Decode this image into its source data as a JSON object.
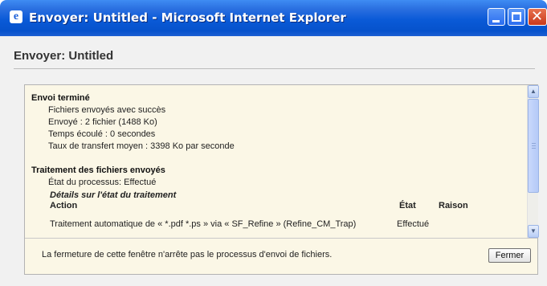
{
  "window": {
    "title": "Envoyer: Untitled - Microsoft Internet Explorer",
    "app_icon": "ie-icon",
    "controls": [
      "minimize-icon",
      "maximize-icon",
      "close-icon"
    ]
  },
  "page": {
    "title": "Envoyer: Untitled"
  },
  "upload": {
    "title": "Envoi terminé",
    "lines": [
      "Fichiers envoyés avec succès",
      "Envoyé : 2 fichier (1488 Ko)",
      "Temps écoulé : 0 secondes",
      "Taux de transfert moyen : 3398 Ko par seconde"
    ]
  },
  "processing": {
    "title": "Traitement des fichiers envoyés",
    "status_line": "État du processus: Effectué",
    "details_title": "Détails sur l'état du traitement",
    "columns": [
      "Action",
      "État",
      "Raison"
    ],
    "rows": [
      [
        "Traitement automatique de « *.pdf *.ps » via « SF_Refine » (Refine_CM_Trap)",
        "Effectué",
        ""
      ]
    ]
  },
  "footer": {
    "note": "La fermeture de cette fenêtre n'arrête pas le processus d'envoi de fichiers.",
    "close_label": "Fermer"
  },
  "colors": {
    "titlebar": "#0a5ad7",
    "panel_bg": "#fbf7e6",
    "client_bg": "#f1f1f1",
    "close_button": "#c9391b"
  }
}
